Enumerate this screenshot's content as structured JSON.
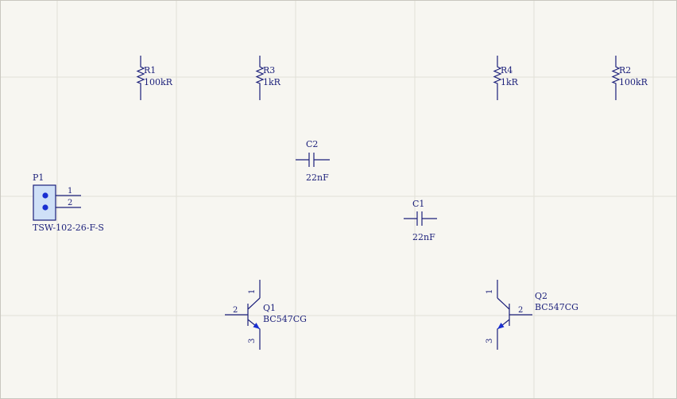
{
  "colors": {
    "background": "#f7f6f1",
    "grid": "#e2e0d8",
    "component": "#1b1f7a",
    "connector_fill": "#cfe0f7",
    "pin_dot": "#1a2fd1"
  },
  "components": {
    "R1": {
      "designator": "R1",
      "value": "100kR"
    },
    "R3": {
      "designator": "R3",
      "value": "1kR"
    },
    "R4": {
      "designator": "R4",
      "value": "1kR"
    },
    "R2": {
      "designator": "R2",
      "value": "100kR"
    },
    "C2": {
      "designator": "C2",
      "value": "22nF"
    },
    "C1": {
      "designator": "C1",
      "value": "22nF"
    },
    "P1": {
      "designator": "P1",
      "value": "TSW-102-26-F-S",
      "pins": [
        "1",
        "2"
      ]
    },
    "Q1": {
      "designator": "Q1",
      "value": "BC547CG",
      "pins": [
        "1",
        "2",
        "3"
      ]
    },
    "Q2": {
      "designator": "Q2",
      "value": "BC547CG",
      "pins": [
        "1",
        "2",
        "3"
      ]
    }
  }
}
